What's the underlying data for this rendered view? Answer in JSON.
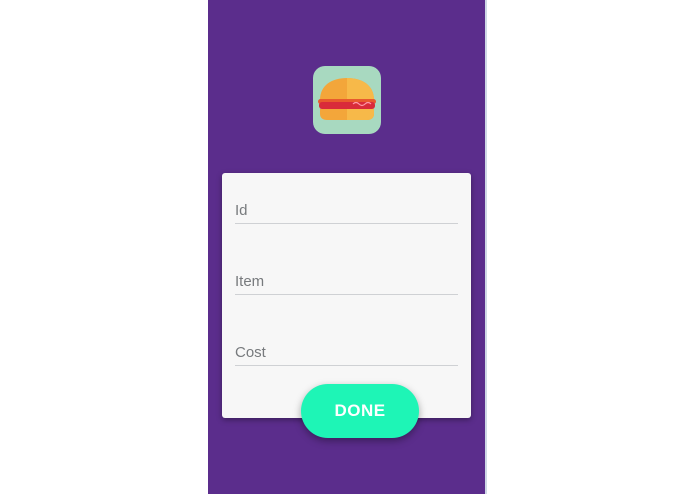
{
  "app": {
    "logo_icon": "burger-icon",
    "colors": {
      "background": "#5b2d8c",
      "card": "#f7f7f7",
      "accent": "#1ef5b6",
      "logo_bg": "#a8d9c0"
    }
  },
  "form": {
    "id_placeholder": "Id",
    "item_placeholder": "Item",
    "cost_placeholder": "Cost",
    "id_value": "",
    "item_value": "",
    "cost_value": "",
    "done_label": "DONE"
  }
}
